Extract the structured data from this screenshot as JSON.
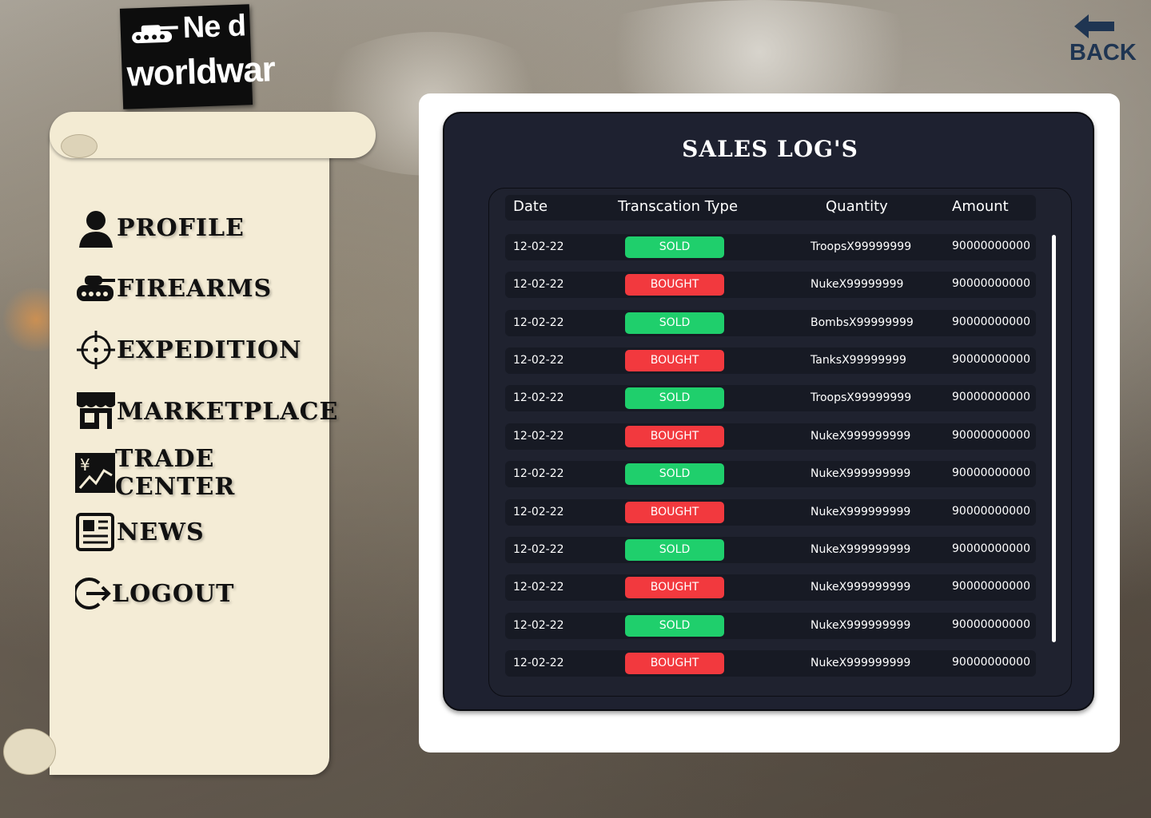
{
  "logo": {
    "line1": "Ne d",
    "line2": "worldwar"
  },
  "nav": [
    {
      "label": "PROFILE",
      "icon": "person-icon"
    },
    {
      "label": "FIREARMS",
      "icon": "tank-icon"
    },
    {
      "label": "EXPEDITION",
      "icon": "crosshair-icon"
    },
    {
      "label": "MARKETPLACE",
      "icon": "shop-icon"
    },
    {
      "label": "TRADE CENTER",
      "icon": "yen-chart-icon"
    },
    {
      "label": "NEWS",
      "icon": "newspaper-icon"
    },
    {
      "label": "LOGOUT",
      "icon": "logout-icon"
    }
  ],
  "back": {
    "label": "BACK",
    "icon": "back-arrow-icon"
  },
  "sales": {
    "title": "SALES LOG'S",
    "columns": [
      "Date",
      "Transcation Type",
      "Quantity",
      "Amount"
    ],
    "rows": [
      {
        "date": "12-02-22",
        "type": "SOLD",
        "quantity": "TroopsX99999999",
        "amount": "90000000000"
      },
      {
        "date": "12-02-22",
        "type": "BOUGHT",
        "quantity": "NukeX99999999",
        "amount": "90000000000"
      },
      {
        "date": "12-02-22",
        "type": "SOLD",
        "quantity": "BombsX99999999",
        "amount": "90000000000"
      },
      {
        "date": "12-02-22",
        "type": "BOUGHT",
        "quantity": "TanksX99999999",
        "amount": "90000000000"
      },
      {
        "date": "12-02-22",
        "type": "SOLD",
        "quantity": "TroopsX99999999",
        "amount": "90000000000"
      },
      {
        "date": "12-02-22",
        "type": "BOUGHT",
        "quantity": "NukeX999999999",
        "amount": "90000000000"
      },
      {
        "date": "12-02-22",
        "type": "SOLD",
        "quantity": "NukeX999999999",
        "amount": "90000000000"
      },
      {
        "date": "12-02-22",
        "type": "BOUGHT",
        "quantity": "NukeX999999999",
        "amount": "90000000000"
      },
      {
        "date": "12-02-22",
        "type": "SOLD",
        "quantity": "NukeX999999999",
        "amount": "90000000000"
      },
      {
        "date": "12-02-22",
        "type": "BOUGHT",
        "quantity": "NukeX999999999",
        "amount": "90000000000"
      },
      {
        "date": "12-02-22",
        "type": "SOLD",
        "quantity": "NukeX999999999",
        "amount": "90000000000"
      },
      {
        "date": "12-02-22",
        "type": "BOUGHT",
        "quantity": "NukeX999999999",
        "amount": "90000000000"
      }
    ]
  },
  "colors": {
    "sold": "#1fcf6c",
    "bought": "#f2393e",
    "panel": "#1e2130",
    "row": "#171a24"
  }
}
